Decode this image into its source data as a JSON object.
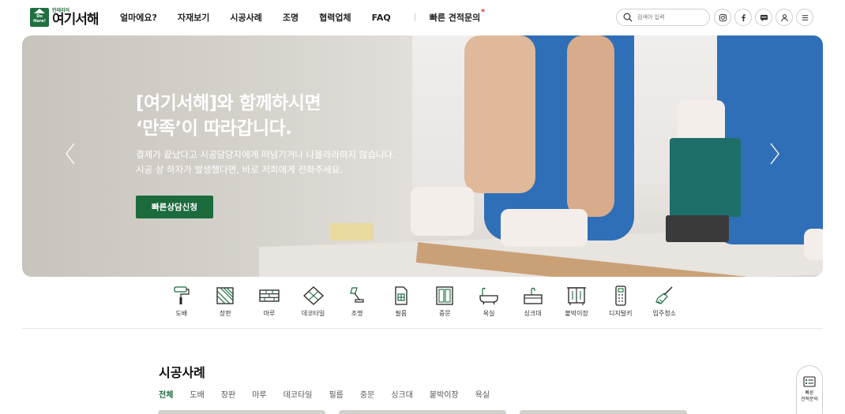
{
  "header": {
    "logo_sub": "인테리어",
    "logo_main": "여기서해",
    "logo_badge": "Do Here!",
    "nav": [
      "얼마에요?",
      "자재보기",
      "시공사례",
      "조명",
      "협력업체",
      "FAQ"
    ],
    "quick_estimate": "빠른 견적문의",
    "quick_estimate_marker": "*",
    "search_placeholder": "검색어 입력",
    "icons": [
      "instagram-icon",
      "facebook-icon",
      "chat-icon",
      "user-icon",
      "menu-icon"
    ]
  },
  "hero": {
    "title": "[여기서해]와 함께하시면\n‘만족’이 따라갑니다.",
    "description": "결제가 끝났다고 시공담당자에게 떠넘기거나 나몰라라하지 않습니다.\n시공 상 하자가 발생했다면, 바로 저희에게 전화주세요.",
    "button": "빠른상담신청"
  },
  "categories": [
    {
      "label": "도배",
      "icon": "paint-roller-icon"
    },
    {
      "label": "장판",
      "icon": "floor-sheet-icon"
    },
    {
      "label": "마루",
      "icon": "wood-floor-icon"
    },
    {
      "label": "데코타일",
      "icon": "deco-tile-icon"
    },
    {
      "label": "조명",
      "icon": "lamp-icon"
    },
    {
      "label": "필름",
      "icon": "film-icon"
    },
    {
      "label": "중문",
      "icon": "door-icon"
    },
    {
      "label": "욕실",
      "icon": "bathtub-icon"
    },
    {
      "label": "싱크대",
      "icon": "sink-icon"
    },
    {
      "label": "붙박이장",
      "icon": "wardrobe-icon"
    },
    {
      "label": "디지털키",
      "icon": "digital-key-icon"
    },
    {
      "label": "입주청소",
      "icon": "cleaning-brush-icon"
    }
  ],
  "section": {
    "title": "시공사례",
    "filters": [
      "전체",
      "도배",
      "장판",
      "마루",
      "데코타일",
      "필름",
      "중문",
      "싱크대",
      "붙박이장",
      "욕실"
    ],
    "active_filter": "전체"
  },
  "quick_float": {
    "label": "빠른\n견적문의"
  },
  "colors": {
    "brand_green": "#1b6b3d",
    "accent_red": "#e53935"
  }
}
